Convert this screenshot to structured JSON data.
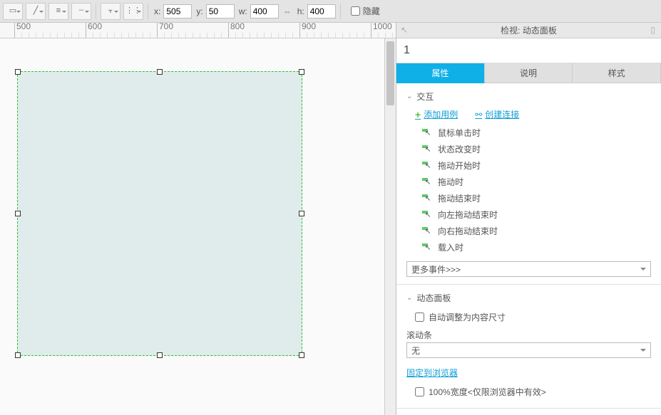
{
  "toolbar": {
    "x_label": "x:",
    "x_value": "505",
    "y_label": "y:",
    "y_value": "50",
    "w_label": "w:",
    "w_value": "400",
    "h_label": "h:",
    "h_value": "400",
    "hide_label": "隐藏"
  },
  "ruler": {
    "ticks": [
      "500",
      "600",
      "700",
      "800",
      "900",
      "1000"
    ]
  },
  "inspector": {
    "title": "检视: 动态面板",
    "state_name": "1",
    "tabs": [
      "属性",
      "说明",
      "样式"
    ],
    "active_tab": 0,
    "interaction": {
      "title": "交互",
      "add_case": "添加用例",
      "create_link": "创建连接",
      "events": [
        "鼠标单击时",
        "状态改变时",
        "拖动开始时",
        "拖动时",
        "拖动结束时",
        "向左拖动结束时",
        "向右拖动结束时",
        "载入时"
      ],
      "more_events": "更多事件>>>"
    },
    "dynamic_panel": {
      "title": "动态面板",
      "fit_content": "自动调整为内容尺寸",
      "scrollbar_label": "滚动条",
      "scrollbar_value": "无",
      "pin_browser": "固定到浏览器",
      "full_width": "100%宽度<仅限浏览器中有效>"
    }
  }
}
